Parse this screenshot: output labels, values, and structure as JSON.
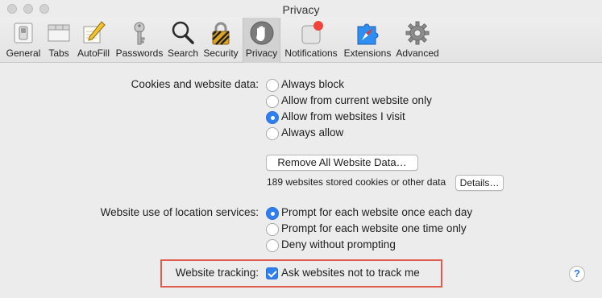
{
  "window": {
    "title": "Privacy"
  },
  "toolbar": {
    "items": [
      {
        "label": "General",
        "icon": "switch-icon"
      },
      {
        "label": "Tabs",
        "icon": "tabs-icon"
      },
      {
        "label": "AutoFill",
        "icon": "pencil-icon"
      },
      {
        "label": "Passwords",
        "icon": "key-icon"
      },
      {
        "label": "Search",
        "icon": "magnifier-icon"
      },
      {
        "label": "Security",
        "icon": "lock-icon"
      },
      {
        "label": "Privacy",
        "icon": "hand-icon",
        "active": true
      },
      {
        "label": "Notifications",
        "icon": "notification-badge-icon"
      },
      {
        "label": "Extensions",
        "icon": "compass-icon"
      },
      {
        "label": "Advanced",
        "icon": "gear-icon"
      }
    ]
  },
  "cookies": {
    "label": "Cookies and website data:",
    "options": [
      {
        "label": "Always block",
        "selected": false
      },
      {
        "label": "Allow from current website only",
        "selected": false
      },
      {
        "label": "Allow from websites I visit",
        "selected": true
      },
      {
        "label": "Always allow",
        "selected": false
      }
    ],
    "remove_button": "Remove All Website Data…",
    "stored_text": "189 websites stored cookies or other data",
    "details_button": "Details…"
  },
  "location": {
    "label": "Website use of location services:",
    "options": [
      {
        "label": "Prompt for each website once each day",
        "selected": true
      },
      {
        "label": "Prompt for each website one time only",
        "selected": false
      },
      {
        "label": "Deny without prompting",
        "selected": false
      }
    ]
  },
  "tracking": {
    "label": "Website tracking:",
    "checkbox_label": "Ask websites not to track me",
    "checked": true
  },
  "help": {
    "label": "?"
  },
  "colors": {
    "accent": "#2f7ff0",
    "highlight": "#e25c4e",
    "badge": "#f0443a"
  }
}
